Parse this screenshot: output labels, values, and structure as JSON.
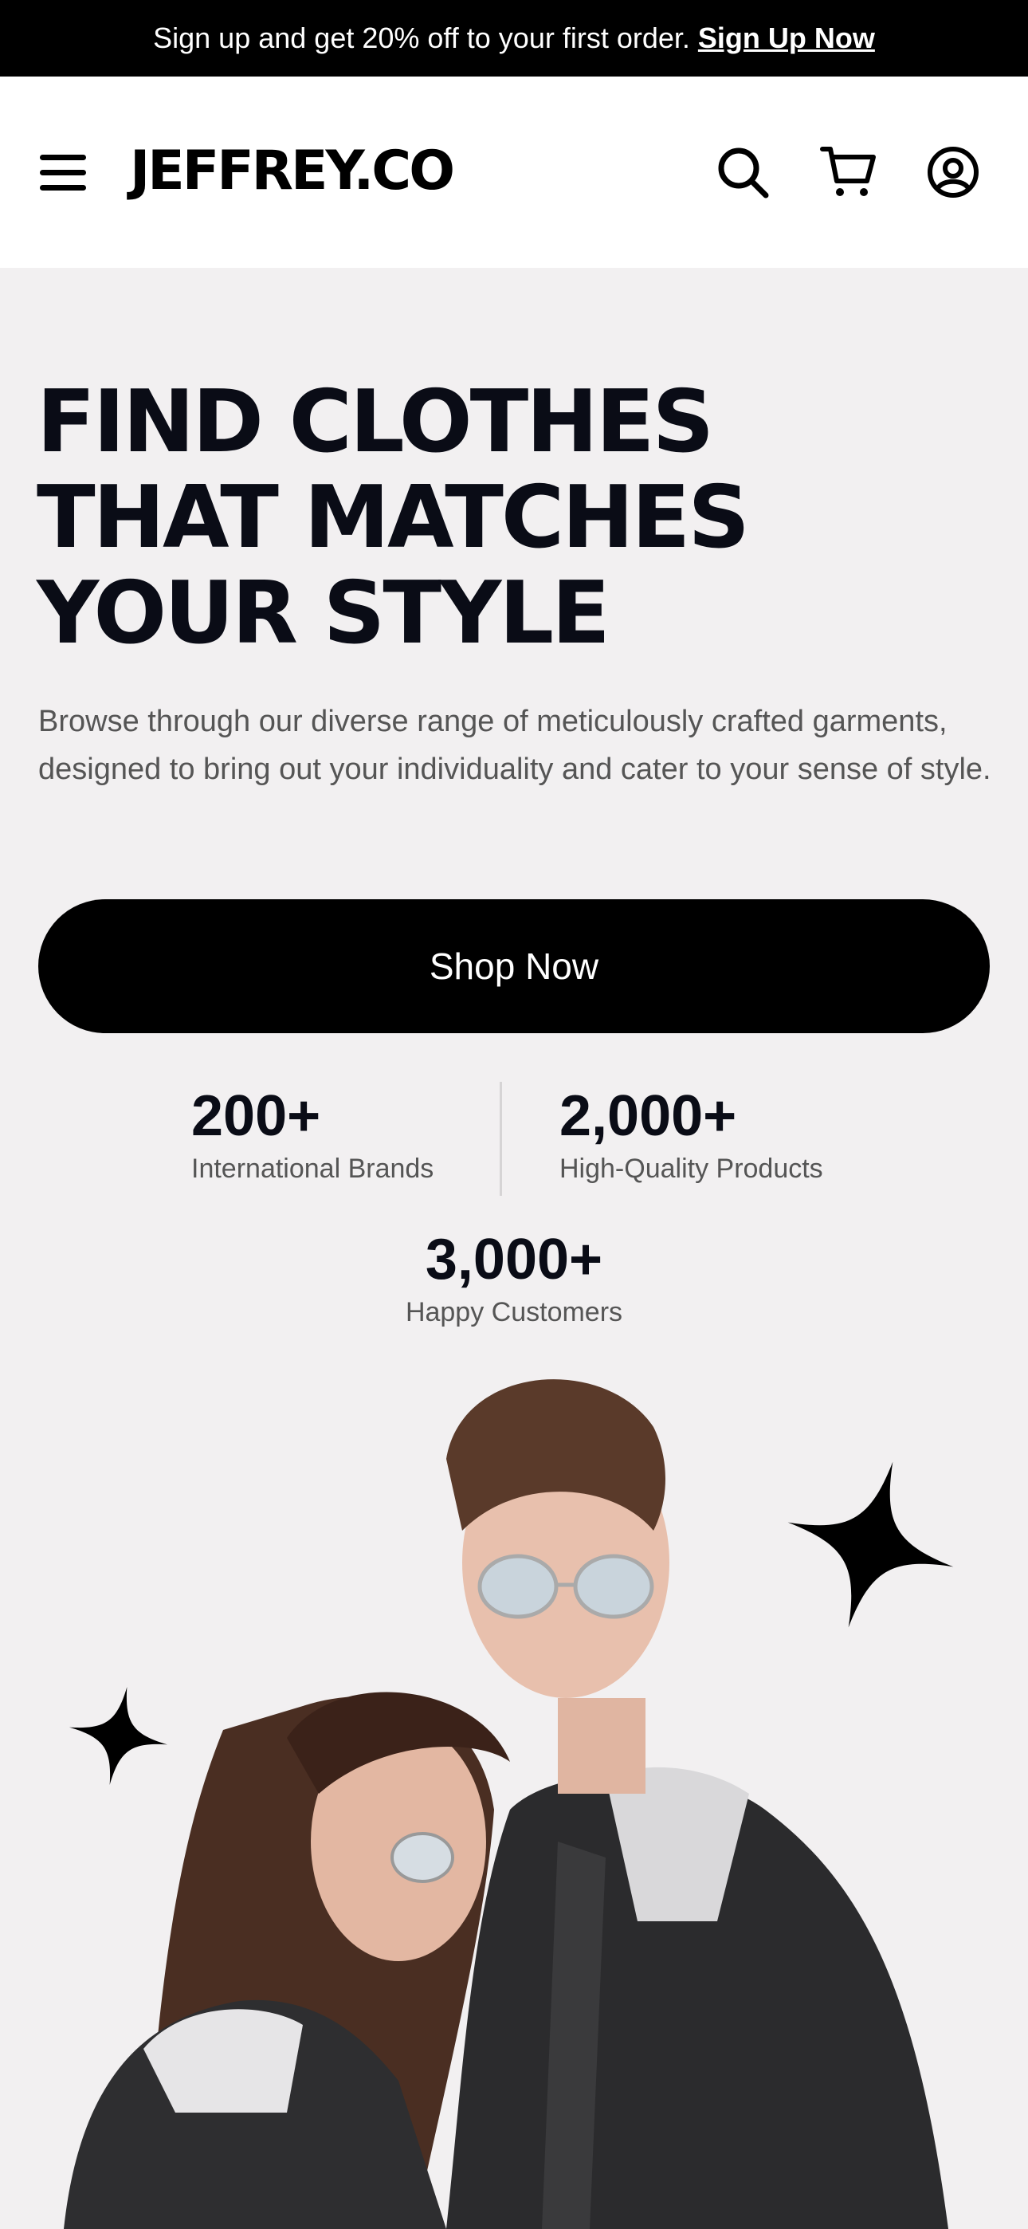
{
  "promo": {
    "text": "Sign up and get 20% off to your first order.",
    "link_label": "Sign Up Now"
  },
  "header": {
    "logo": "JEFFREY.CO",
    "icons": [
      "menu-icon",
      "search-icon",
      "cart-icon",
      "account-icon"
    ]
  },
  "hero": {
    "title_lines": [
      "FIND CLOTHES",
      "THAT MATCHES",
      "YOUR STYLE"
    ],
    "description": "Browse through our diverse range of meticulously crafted garments, designed to bring out your individuality and cater to your sense of style.",
    "cta_label": "Shop Now"
  },
  "stats": [
    {
      "value": "200+",
      "label": "International Brands"
    },
    {
      "value": "2,000+",
      "label": "High-Quality Products"
    },
    {
      "value": "3,000+",
      "label": "Happy Customers"
    }
  ],
  "colors": {
    "background": "#f2f0f1",
    "promo_bg": "#000000",
    "text_dark": "#0a0c16",
    "text_muted": "#555555"
  }
}
